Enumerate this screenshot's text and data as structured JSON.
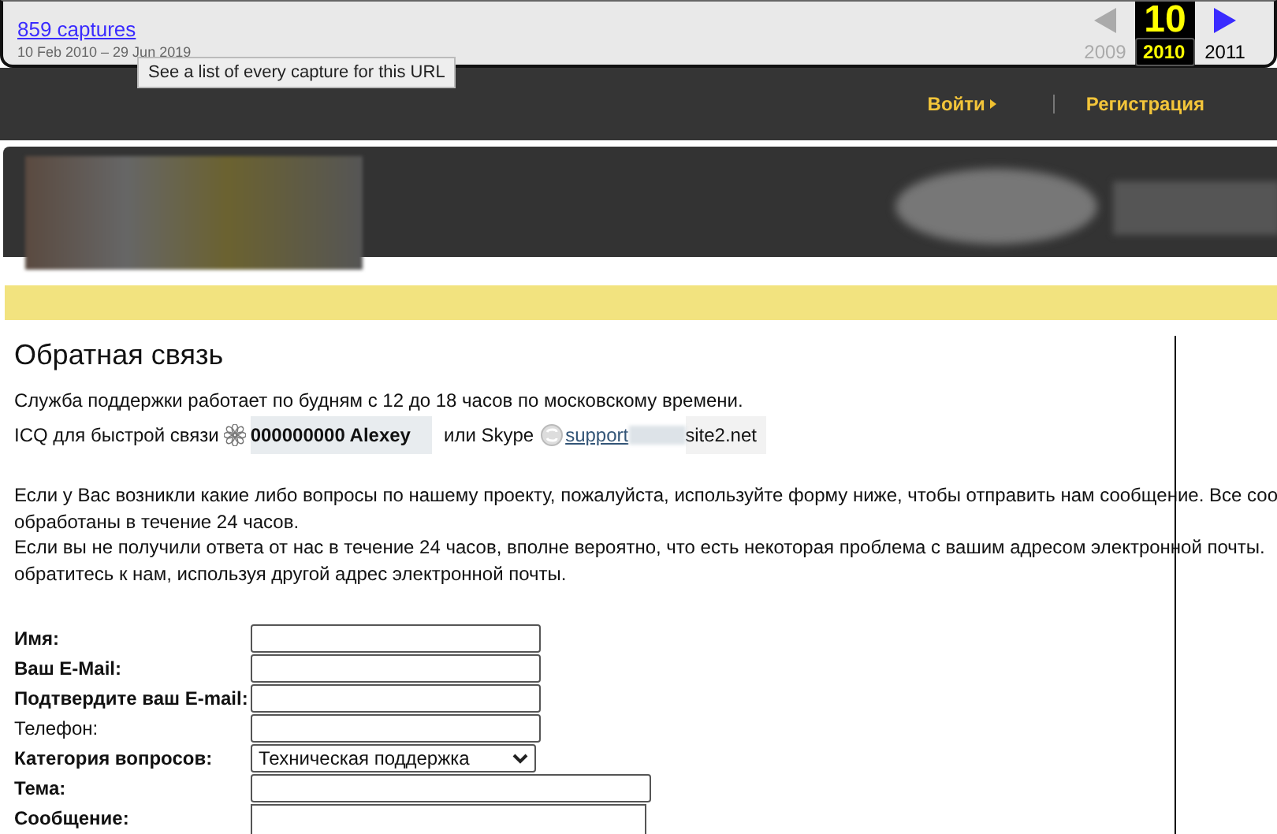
{
  "wayback": {
    "captures_link": "859 captures",
    "date_range": "10 Feb 2010 – 29 Jun 2019",
    "tooltip": "See a list of every capture for this URL",
    "day": "10",
    "years": [
      {
        "label": "2009",
        "selected": false
      },
      {
        "label": "2010",
        "selected": true
      },
      {
        "label": "2011",
        "selected": false
      }
    ]
  },
  "nav": {
    "links": [
      {
        "label": "Войти",
        "arrow": true
      },
      {
        "label": "Регистрация",
        "arrow": false
      }
    ]
  },
  "content": {
    "title": "Обратная связь",
    "hours": "Служба поддержки работает по будням с 12 до 18 часов по московскому времени.",
    "icq_label": "ICQ для быстрой связи",
    "icq_contact": "000000000 Alexey",
    "skype_label": "или Skype",
    "skype_link": "support",
    "skype_domain": "site2.net",
    "paragraph_lines": [
      "Если у Вас возникли какие либо вопросы по нашему проекту, пожалуйста, используйте форму ниже, чтобы отправить нам сообщение. Все соо",
      "обработаны в течение 24 часов.",
      "Если вы не получили ответа от нас в течение 24 часов, вполне вероятно, что есть некоторая проблема с вашим адресом электронной почты.",
      "обратитесь к нам, используя другой адрес электронной почты."
    ]
  },
  "form": {
    "fields": [
      {
        "label": "Имя:",
        "kind": "text",
        "required": true
      },
      {
        "label": "Ваш E-Mail:",
        "kind": "text",
        "required": true
      },
      {
        "label": "Подтвердите ваш E-mail:",
        "kind": "text",
        "required": true
      },
      {
        "label": "Телефон:",
        "kind": "text",
        "required": false
      },
      {
        "label": "Категория вопросов:",
        "kind": "select",
        "required": true,
        "value": "Техническая поддержка"
      },
      {
        "label": "Тема:",
        "kind": "wide",
        "required": true
      },
      {
        "label": "Сообщение:",
        "kind": "textarea",
        "required": true
      }
    ]
  }
}
